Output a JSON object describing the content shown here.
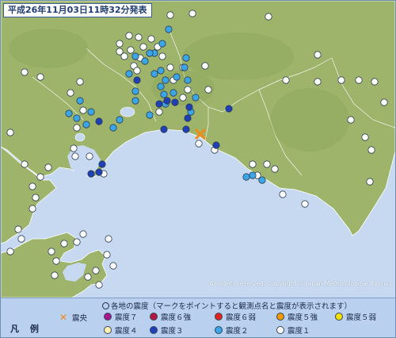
{
  "title": "平成26年11月03日11時32分発表",
  "copyright": "All rights reserved. Copyright © Japan Meteorological Agency",
  "colors": {
    "sea": "#c7d9f0",
    "land": "#9db46a",
    "land_dark": "#8aa358",
    "border": "#ffffff",
    "intensity_1": "#ffffff",
    "intensity_2": "#3aa6e8",
    "intensity_3": "#1f3fb8",
    "intensity_4": "#fff0b0",
    "intensity_5_weak": "#f5e000",
    "intensity_5_strong": "#f39800",
    "intensity_6_weak": "#e0261b",
    "intensity_6_strong": "#b5163f",
    "intensity_7": "#a6178a",
    "epicenter": "#f08a1a"
  },
  "legend": {
    "label": "凡 例",
    "note": "各地の震度（マークをポイントすると観測点名と震度が表示されます）",
    "epicenter_label": "震央",
    "items": [
      {
        "key": "7",
        "label": "震度７",
        "color": "#a6178a"
      },
      {
        "key": "6s",
        "label": "震度６強",
        "color": "#b5163f"
      },
      {
        "key": "6w",
        "label": "震度６弱",
        "color": "#e0261b"
      },
      {
        "key": "5s",
        "label": "震度５強",
        "color": "#f39800"
      },
      {
        "key": "5w",
        "label": "震度５弱",
        "color": "#f5e000"
      },
      {
        "key": "4",
        "label": "震度４",
        "color": "#fff0b0"
      },
      {
        "key": "3",
        "label": "震度３",
        "color": "#1f3fb8"
      },
      {
        "key": "2",
        "label": "震度２",
        "color": "#3aa6e8"
      },
      {
        "key": "1",
        "label": "震度１",
        "color": "#ffffff"
      }
    ]
  },
  "epicenter": {
    "icon": "epicenter-x-icon"
  },
  "stations": {
    "intensity_1_count": 74,
    "intensity_2_count": 33,
    "intensity_3_count": 14
  }
}
